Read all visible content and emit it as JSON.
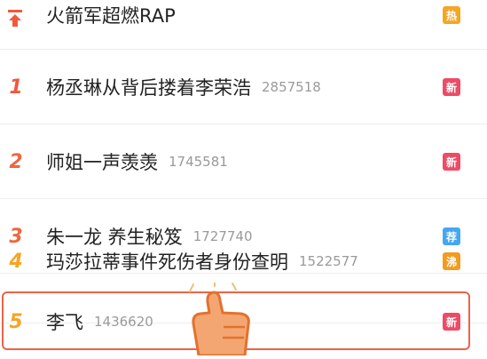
{
  "list": [
    {
      "rank": "",
      "title": "火箭军超燃RAP",
      "count": "",
      "badge": "热",
      "badge_color": "#f5a623",
      "rank_color": "#ef5a3c"
    },
    {
      "rank": "1",
      "title": "杨丞琳从背后搂着李荣浩",
      "count": "2857518",
      "badge": "新",
      "badge_color": "#ee4b67",
      "rank_color": "#ef5a3c"
    },
    {
      "rank": "2",
      "title": "师姐一声羡羡",
      "count": "1745581",
      "badge": "新",
      "badge_color": "#ee4b67",
      "rank_color": "#f0663f"
    },
    {
      "rank": "3",
      "title": "朱一龙 养生秘笈",
      "count": "1727740",
      "badge": "荐",
      "badge_color": "#45a7f0",
      "rank_color": "#f0663f"
    },
    {
      "rank": "4",
      "title": "玛莎拉蒂事件死伤者身份查明",
      "count": "1522577",
      "badge": "沸",
      "badge_color": "#f39b21",
      "rank_color": "#f5a623"
    },
    {
      "rank": "5",
      "title": "李飞",
      "count": "1436620",
      "badge": "新",
      "badge_color": "#ee4b67",
      "rank_color": "#f5a623"
    }
  ]
}
